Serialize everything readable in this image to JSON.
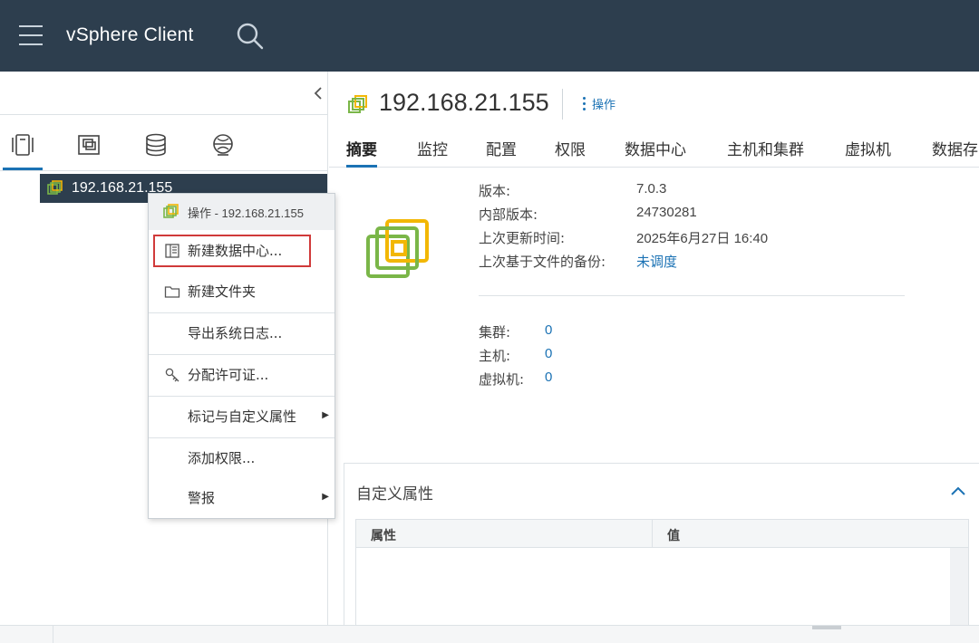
{
  "header": {
    "app_title": "vSphere Client",
    "bg_color": "#2d3e4e",
    "menu_icon": "hamburger-icon",
    "search_icon": "search-icon"
  },
  "left_pane": {
    "nav_tabs": [
      {
        "icon": "hosts-and-clusters-icon",
        "active": true
      },
      {
        "icon": "vms-and-templates-icon",
        "active": false
      },
      {
        "icon": "storage-icon",
        "active": false
      },
      {
        "icon": "networking-icon",
        "active": false
      }
    ],
    "tree_node": {
      "label": "192.168.21.155",
      "icon": "vcenter-icon"
    }
  },
  "context_menu": {
    "header": "操作 - 192.168.21.155",
    "items": [
      {
        "label": "新建数据中心...",
        "icon": "datacenter-icon",
        "highlighted": true
      },
      {
        "label": "新建文件夹",
        "icon": "folder-icon"
      },
      {
        "label": "导出系统日志...",
        "icon": ""
      },
      {
        "label": "分配许可证...",
        "icon": "key-icon"
      },
      {
        "label": "标记与自定义属性",
        "icon": "",
        "submenu": true
      },
      {
        "label": "添加权限...",
        "icon": ""
      },
      {
        "label": "警报",
        "icon": "",
        "submenu": true
      }
    ]
  },
  "object": {
    "title": "192.168.21.155",
    "actions_label": "操作"
  },
  "tabs": [
    {
      "label": "摘要",
      "active": true
    },
    {
      "label": "监控"
    },
    {
      "label": "配置"
    },
    {
      "label": "权限"
    },
    {
      "label": "数据中心"
    },
    {
      "label": "主机和集群"
    },
    {
      "label": "虚拟机"
    },
    {
      "label": "数据存"
    }
  ],
  "summary": {
    "fields": [
      {
        "label": "版本:",
        "value": "7.0.3"
      },
      {
        "label": "内部版本:",
        "value": "24730281"
      },
      {
        "label": "上次更新时间:",
        "value": "2025年6月27日 16:40"
      },
      {
        "label": "上次基于文件的备份:",
        "value": "未调度",
        "link": true
      }
    ],
    "counts": [
      {
        "label": "集群:",
        "value": "0"
      },
      {
        "label": "主机:",
        "value": "0"
      },
      {
        "label": "虚拟机:",
        "value": "0"
      }
    ]
  },
  "custom_attributes": {
    "title": "自定义属性",
    "columns": [
      "属性",
      "值"
    ]
  },
  "colors": {
    "accent": "#1b72b4",
    "icon_green": "#7ab648",
    "icon_yellow": "#f2b705",
    "highlight_red": "#d03a3a"
  }
}
